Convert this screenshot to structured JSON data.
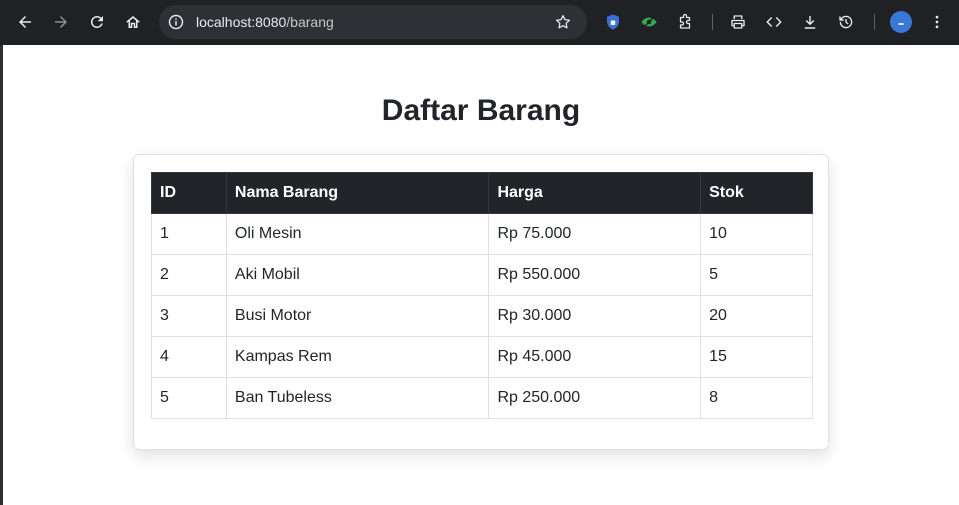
{
  "browser": {
    "url_host": "localhost:8080",
    "url_path": "/barang",
    "colors": {
      "chrome_bg": "#202124",
      "omnibox_bg": "#2d3035",
      "avatar": "#3a78d8"
    },
    "icons": [
      "back-arrow-icon",
      "forward-arrow-icon",
      "reload-icon",
      "home-icon",
      "site-info-icon",
      "bookmark-star-icon",
      "shield-extension-icon",
      "eye-extension-icon",
      "extensions-puzzle-icon",
      "print-icon",
      "code-icon",
      "download-icon",
      "history-icon",
      "menu-dots-icon"
    ]
  },
  "page": {
    "title": "Daftar Barang"
  },
  "table": {
    "headers": [
      "ID",
      "Nama Barang",
      "Harga",
      "Stok"
    ],
    "rows": [
      [
        "1",
        "Oli Mesin",
        "Rp 75.000",
        "10"
      ],
      [
        "2",
        "Aki Mobil",
        "Rp 550.000",
        "5"
      ],
      [
        "3",
        "Busi Motor",
        "Rp 30.000",
        "20"
      ],
      [
        "4",
        "Kampas Rem",
        "Rp 45.000",
        "15"
      ],
      [
        "5",
        "Ban Tubeless",
        "Rp 250.000",
        "8"
      ]
    ],
    "colors": {
      "header_bg": "#212529",
      "header_text": "#ffffff",
      "border": "#dee2e6"
    }
  }
}
